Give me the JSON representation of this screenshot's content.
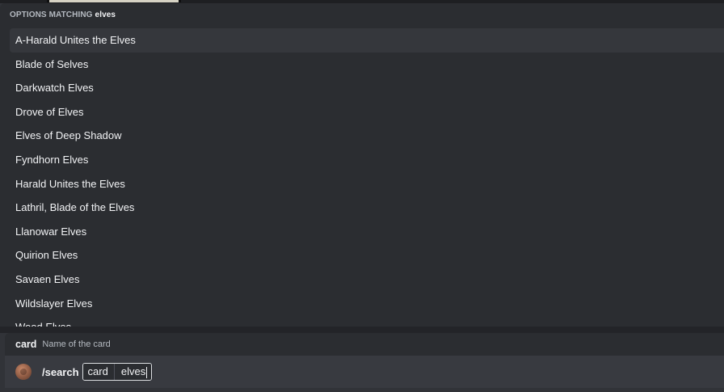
{
  "autocomplete": {
    "header_label": "OPTIONS MATCHING",
    "query": "elves",
    "options": [
      "A-Harald Unites the Elves",
      "Blade of Selves",
      "Darkwatch Elves",
      "Drove of Elves",
      "Elves of Deep Shadow",
      "Fyndhorn Elves",
      "Harald Unites the Elves",
      "Lathril, Blade of the Elves",
      "Llanowar Elves",
      "Quirion Elves",
      "Savaen Elves",
      "Wildslayer Elves",
      "Wood Elves"
    ],
    "selected_index": 0
  },
  "parameter_hint": {
    "name": "card",
    "description": "Name of the card"
  },
  "command_input": {
    "command": "/search",
    "option_name": "card",
    "option_value": "elves",
    "app_icon": "bot-avatar-icon"
  },
  "colors": {
    "background": "#313338",
    "popup": "#2b2d31",
    "selected": "#35373c",
    "input": "#383a40",
    "text": "#f2f3f5",
    "muted": "#b5bac1"
  }
}
